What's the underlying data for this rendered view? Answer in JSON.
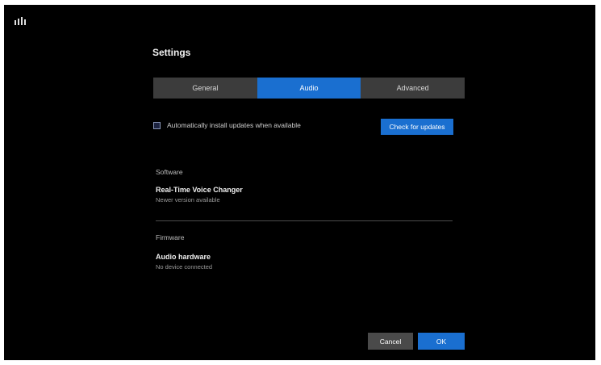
{
  "dialog": {
    "title": "Settings"
  },
  "tabs": [
    {
      "label": "General"
    },
    {
      "label": "Audio"
    },
    {
      "label": "Advanced"
    }
  ],
  "options": {
    "auto_update_label": "Automatically install updates when available",
    "check_button": "Check for updates"
  },
  "sections": [
    {
      "heading": "Software",
      "item_title": "Real-Time Voice Changer",
      "item_subtitle": "Newer version available"
    },
    {
      "heading": "Firmware",
      "item_title": "Audio hardware",
      "item_subtitle": "No device connected"
    }
  ],
  "footer": {
    "cancel_label": "Cancel",
    "ok_label": "OK"
  },
  "colors": {
    "accent": "#1a6fd0",
    "background": "#000000",
    "tab_bar": "#3c3c3c"
  }
}
